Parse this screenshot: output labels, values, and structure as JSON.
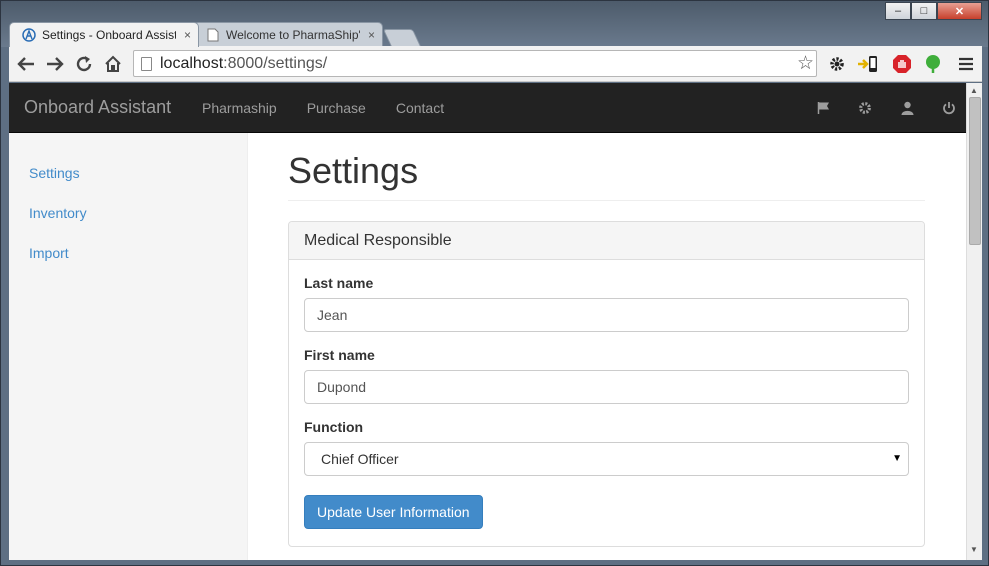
{
  "browser": {
    "tabs": [
      {
        "title": "Settings - Onboard Assista",
        "active": true,
        "favicon": "onboard-logo-icon"
      },
      {
        "title": "Welcome to PharmaShip's",
        "active": false,
        "favicon": "page-icon"
      }
    ],
    "tab_close": "×",
    "url_host": "localhost",
    "url_path": ":8000/settings/",
    "window_controls": {
      "minimize": "–",
      "maximize": "□",
      "close": "✕"
    }
  },
  "navbar": {
    "brand": "Onboard Assistant",
    "links": [
      "Pharmaship",
      "Purchase",
      "Contact"
    ],
    "icons": [
      "flag-icon",
      "gear-icon",
      "user-icon",
      "power-icon"
    ]
  },
  "sidebar": {
    "items": [
      {
        "label": "Settings"
      },
      {
        "label": "Inventory"
      },
      {
        "label": "Import"
      }
    ]
  },
  "main": {
    "title": "Settings",
    "panel": {
      "heading": "Medical Responsible",
      "last_name_label": "Last name",
      "last_name_value": "Jean",
      "first_name_label": "First name",
      "first_name_value": "Dupond",
      "function_label": "Function",
      "function_value": "Chief Officer",
      "submit_label": "Update User Information"
    }
  },
  "colors": {
    "navbar_bg": "#222222",
    "link": "#428bca",
    "primary_button": "#428bca"
  }
}
